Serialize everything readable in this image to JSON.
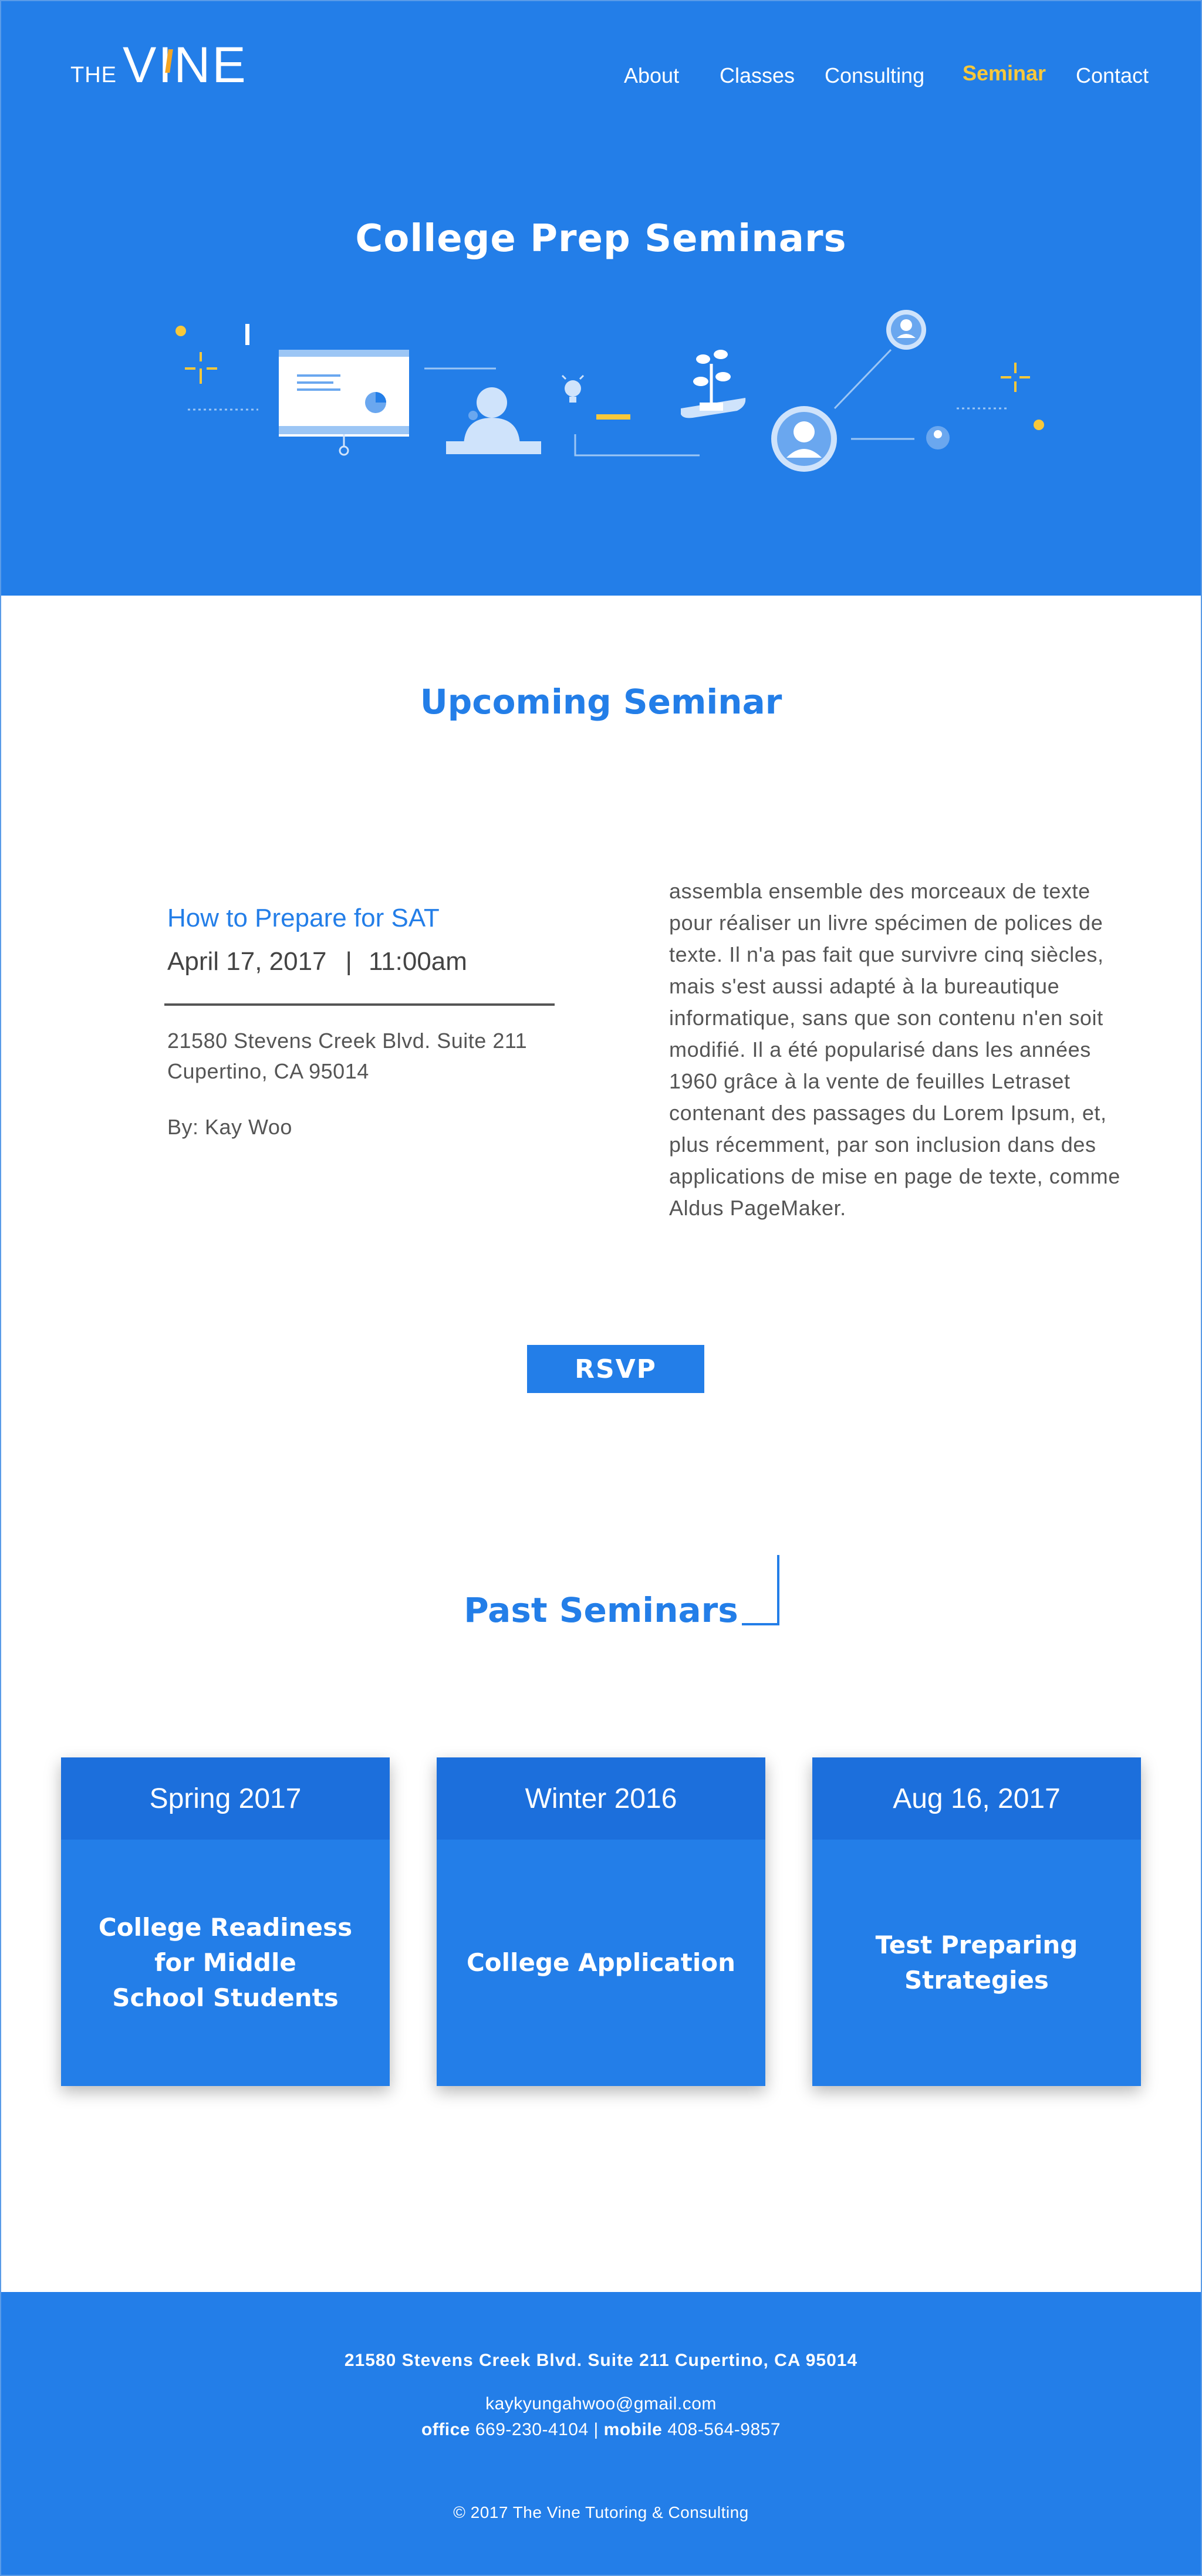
{
  "brand": {
    "prefix": "THE",
    "name": "VINE",
    "accent_color": "#f5a623"
  },
  "nav": {
    "items": [
      {
        "label": "About",
        "active": false
      },
      {
        "label": "Classes",
        "active": false
      },
      {
        "label": "Consulting",
        "active": false
      },
      {
        "label": "Seminar",
        "active": true
      },
      {
        "label": "Contact",
        "active": false
      }
    ],
    "active_color": "#f8c83a"
  },
  "hero": {
    "title": "College Prep Seminars",
    "background_color": "#237ee8"
  },
  "upcoming": {
    "heading": "Upcoming Seminar",
    "title": "How to Prepare for SAT",
    "date": "April 17, 2017",
    "separator": "|",
    "time": "11:00am",
    "address_line1": "21580 Stevens Creek Blvd. Suite 211",
    "address_line2": "Cupertino, CA 95014",
    "presenter": "By: Kay Woo",
    "description": "assembla ensemble des morceaux de texte pour réaliser un livre spécimen de polices de texte. Il n'a pas fait que survivre cinq siècles, mais s'est aussi adapté à la bureautique informatique, sans que son contenu n'en soit modifié. Il a été popularisé dans les années 1960 grâce à la vente de feuilles Letraset contenant des passages du Lorem Ipsum, et, plus récemment, par son inclusion dans des applications de mise en page de texte, comme Aldus PageMaker.",
    "rsvp_label": "RSVP"
  },
  "past": {
    "heading": "Past Seminars",
    "cards": [
      {
        "date": "Spring 2017",
        "title": "College Readiness\nfor Middle\nSchool Students"
      },
      {
        "date": "Winter 2016",
        "title": "College Application"
      },
      {
        "date": "Aug 16, 2017",
        "title": "Test Preparing\nStrategies"
      }
    ]
  },
  "footer": {
    "address": "21580 Stevens Creek Blvd. Suite 211 Cupertino, CA 95014",
    "email": "kaykyungahwoo@gmail.com",
    "office_label": "office",
    "office_phone": "669-230-4104",
    "divider": "|",
    "mobile_label": "mobile",
    "mobile_phone": "408-564-9857",
    "copyright": "© 2017 The Vine Tutoring & Consulting"
  },
  "icons": [
    "presentation-icon",
    "speaker-icon",
    "lightbulb-icon",
    "plant-in-hand-icon",
    "user-avatar-icon",
    "sparkle-icon"
  ]
}
